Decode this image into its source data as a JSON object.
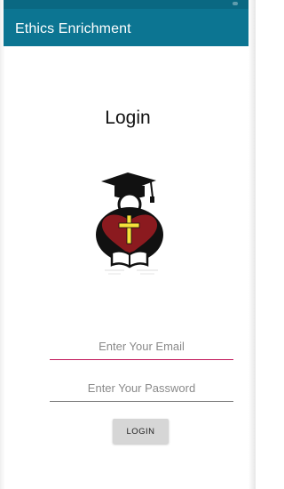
{
  "app_bar": {
    "title": "Ethics Enrichment",
    "color": "#0c7592"
  },
  "login": {
    "heading": "Login",
    "logo": "graduate-heart-cross-book-logo",
    "email_placeholder": "Enter Your Email",
    "password_placeholder": "Enter Your Password",
    "button_label": "LOGIN",
    "focus_accent": "#c2185b"
  }
}
